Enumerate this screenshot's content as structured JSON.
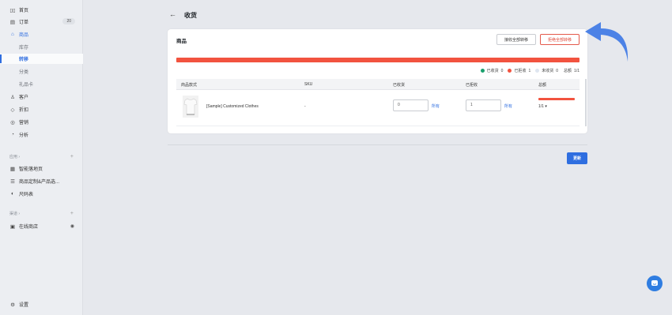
{
  "sidebar": {
    "home": "首页",
    "orders": "订单",
    "orders_badge": "20",
    "products": "商品",
    "inventory": "库存",
    "transfers": "转移",
    "collections": "分类",
    "gift_cards": "礼品卡",
    "customers": "客户",
    "discounts": "折扣",
    "marketing": "营销",
    "analytics": "分析",
    "apps_section": "应用 ›",
    "app_1": "智能落地页",
    "app_2": "商品定制&产品选...",
    "app_3": "尺码表",
    "channels_section": "渠道 ›",
    "online_store": "在线商店",
    "settings": "设置"
  },
  "page": {
    "title": "收货"
  },
  "card": {
    "title": "商品",
    "accept_all": "接收全部转移",
    "reject_all": "拒绝全部转移",
    "progress": 1.0,
    "legend": [
      {
        "label": "已收货",
        "count": "0",
        "color": "#1aa06d"
      },
      {
        "label": "已拒收",
        "count": "1",
        "color": "#f2533f"
      },
      {
        "label": "未收货",
        "count": "0",
        "color": "#dfe6f0"
      }
    ],
    "total_label": "总额",
    "total_value": "1/1",
    "columns": {
      "item": "商品款式",
      "sku": "SKU",
      "received": "已收货",
      "rejected": "已拒收",
      "total": "总额"
    },
    "row": {
      "name": "[Sample] Customized Clothes",
      "sku": "-",
      "received_value": "0",
      "received_all": "所有",
      "rejected_value": "1",
      "rejected_all": "所有",
      "total": "1/1 ▾"
    }
  },
  "footer": {
    "update": "更新"
  },
  "colors": {
    "accent": "#2f6ee0",
    "reject": "#f2533f",
    "callout": "#4c82e6"
  }
}
